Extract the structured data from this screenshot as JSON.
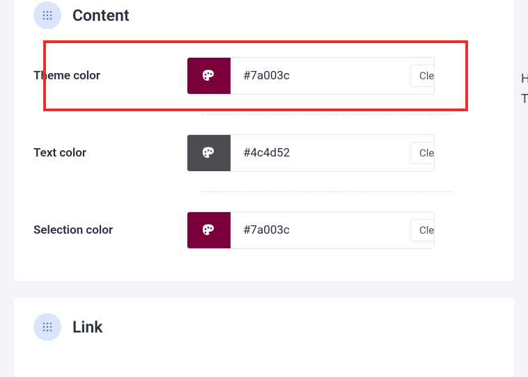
{
  "colors": {
    "theme": "#7a003c",
    "text": "#4c4d52",
    "selection": "#7a003c"
  },
  "sections": {
    "content": {
      "title": "Content"
    },
    "link": {
      "title": "Link"
    }
  },
  "rows": {
    "theme": {
      "label": "Theme color",
      "value": "#7a003c",
      "clear": "Clear"
    },
    "text": {
      "label": "Text color",
      "value": "#4c4d52",
      "clear": "Clear"
    },
    "selection": {
      "label": "Selection color",
      "value": "#7a003c",
      "clear": "Clear"
    }
  },
  "hint": {
    "line1": "Hi",
    "line2": "To"
  }
}
